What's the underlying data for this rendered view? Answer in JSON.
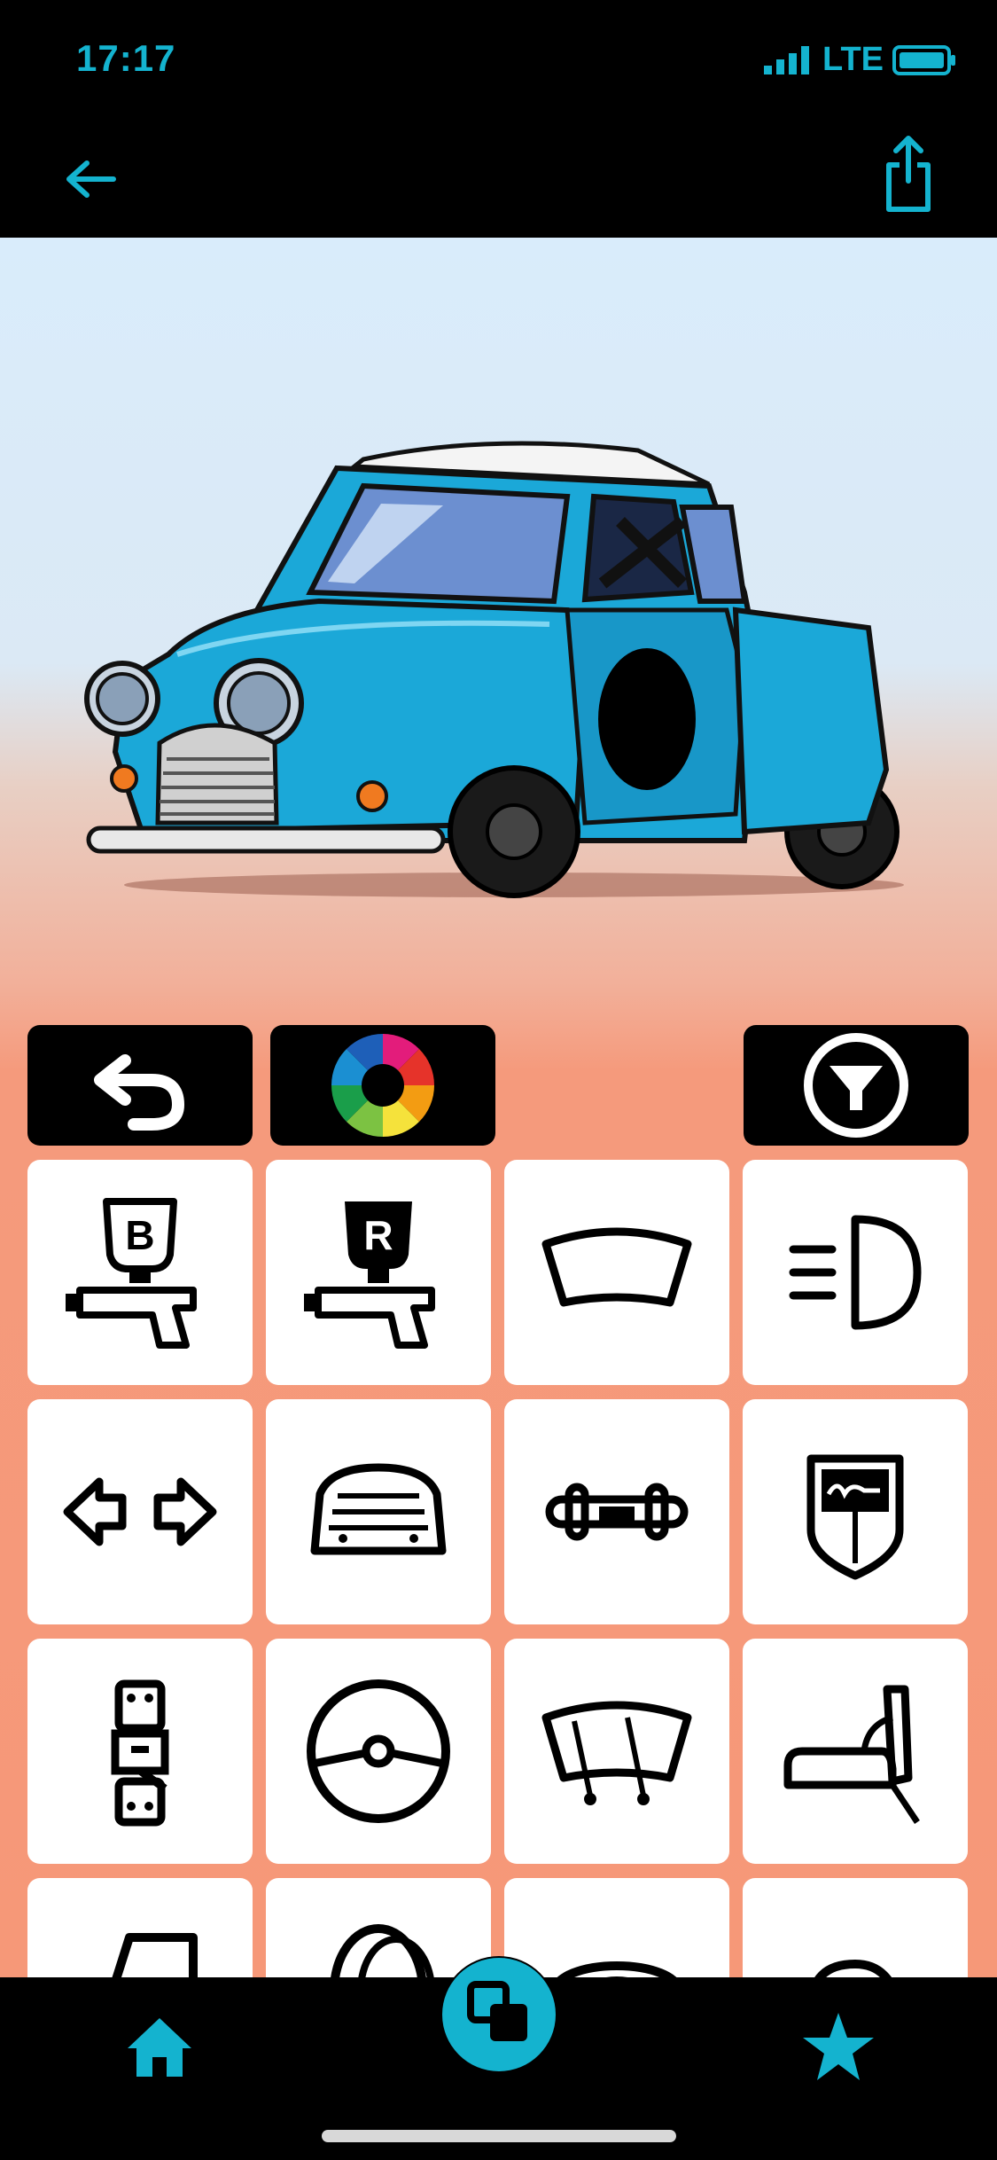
{
  "status_bar": {
    "time": "17:17",
    "network": "LTE",
    "icons": [
      "signal-icon",
      "battery-icon"
    ]
  },
  "nav": {
    "back_icon": "back-arrow-icon",
    "share_icon": "share-icon"
  },
  "colors": {
    "accent": "#14b3cf",
    "background_top": "#d9ecfb",
    "background_bottom": "#f69878",
    "car_body": "#1ba8d8"
  },
  "toolbar": [
    {
      "icon": "undo-icon"
    },
    {
      "icon": "color-wheel-icon"
    },
    {
      "icon": "filter-icon"
    }
  ],
  "parts": [
    {
      "icon": "base-paint-spray-gun-icon",
      "label": "B"
    },
    {
      "icon": "roof-paint-spray-gun-icon",
      "label": "R"
    },
    {
      "icon": "windshield-icon"
    },
    {
      "icon": "headlight-icon"
    },
    {
      "icon": "indicators-icon"
    },
    {
      "icon": "grille-icon"
    },
    {
      "icon": "bumper-icon"
    },
    {
      "icon": "badge-icon"
    },
    {
      "icon": "seatbelt-icon"
    },
    {
      "icon": "steering-wheel-icon"
    },
    {
      "icon": "wipers-icon"
    },
    {
      "icon": "seat-icon"
    },
    {
      "icon": "door-icon"
    },
    {
      "icon": "tire-icon"
    },
    {
      "icon": "wheel-icon"
    },
    {
      "icon": "mirror-icon"
    }
  ],
  "tab_bar": [
    "home-icon",
    "garage-icon",
    "favorites-star-icon"
  ]
}
